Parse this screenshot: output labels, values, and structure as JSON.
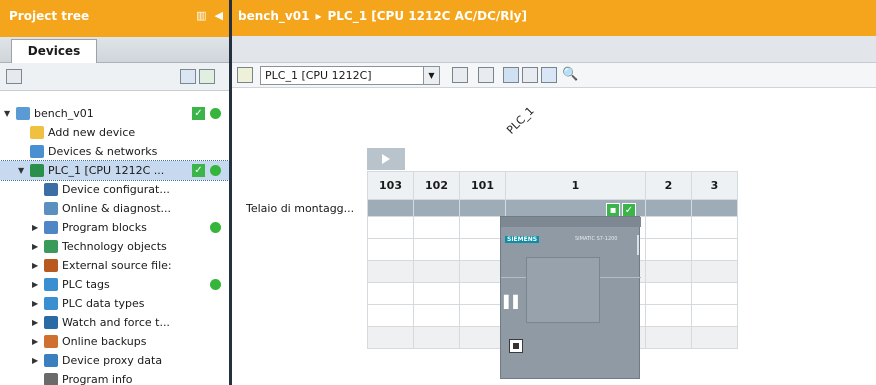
{
  "project_tree": {
    "title": "Project tree",
    "tab": "Devices",
    "items": [
      {
        "label": "bench_v01",
        "level": 0,
        "expanded": true,
        "check": true,
        "dot": true
      },
      {
        "label": "Add new device",
        "level": 1
      },
      {
        "label": "Devices & networks",
        "level": 1
      },
      {
        "label": "PLC_1 [CPU 1212C ...",
        "level": 1,
        "expanded": true,
        "selected": true,
        "check": true,
        "dot": true
      },
      {
        "label": "Device configurat...",
        "level": 2
      },
      {
        "label": "Online & diagnost...",
        "level": 2
      },
      {
        "label": "Program blocks",
        "level": 2,
        "collapsed": true,
        "dot": true
      },
      {
        "label": "Technology objects",
        "level": 2,
        "collapsed": true
      },
      {
        "label": "External source file:",
        "level": 2,
        "collapsed": true
      },
      {
        "label": "PLC tags",
        "level": 2,
        "collapsed": true,
        "dot": true
      },
      {
        "label": "PLC data types",
        "level": 2,
        "collapsed": true
      },
      {
        "label": "Watch and force t...",
        "level": 2,
        "collapsed": true
      },
      {
        "label": "Online backups",
        "level": 2,
        "collapsed": true
      },
      {
        "label": "Device proxy data",
        "level": 2,
        "collapsed": true
      },
      {
        "label": "Program info",
        "level": 2
      }
    ]
  },
  "breadcrumb": {
    "project": "bench_v01",
    "separator": "▸",
    "device": "PLC_1 [CPU 1212C AC/DC/Rly]"
  },
  "editor": {
    "device_selector": "PLC_1 [CPU 1212C]",
    "plc_label": "PLC_1",
    "rail_label": "Telaio di montagg...",
    "slots": [
      "103",
      "102",
      "101",
      "1",
      "2",
      "3"
    ],
    "cpu_brand": "SIEMENS",
    "cpu_model": "SIMATIC S7-1200"
  },
  "colors": {
    "header_orange": "#f4a51c",
    "status_green": "#3bb54a",
    "rack_band": "#9eacb8",
    "selection": "#c7d9ee"
  }
}
